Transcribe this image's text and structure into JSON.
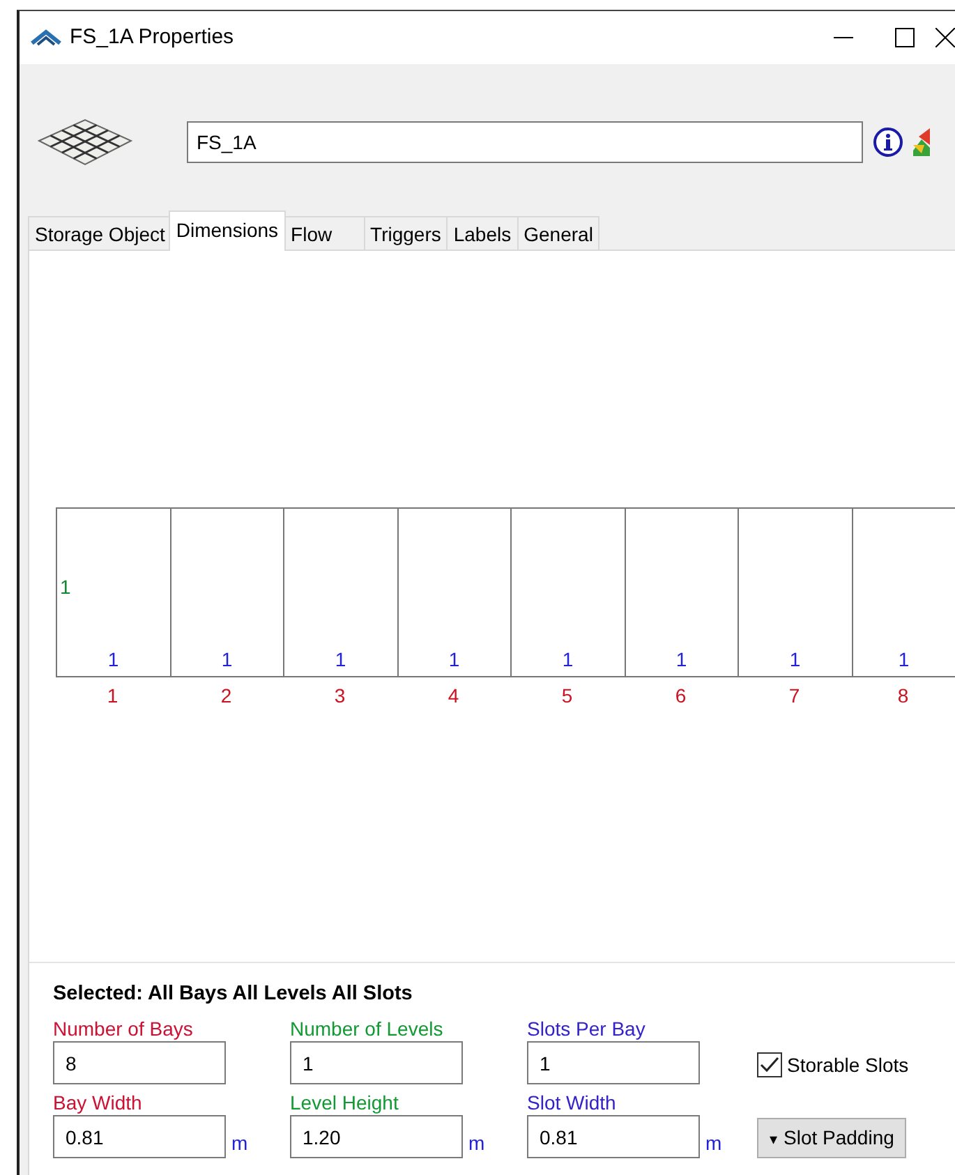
{
  "window": {
    "title": "FS_1A  Properties"
  },
  "object_name": {
    "value": "FS_1A"
  },
  "tabs": [
    {
      "label": "Storage Object",
      "selected": false
    },
    {
      "label": "Dimensions",
      "selected": true
    },
    {
      "label": "Flow",
      "selected": false
    },
    {
      "label": "Triggers",
      "selected": false
    },
    {
      "label": "Labels",
      "selected": false
    },
    {
      "label": "General",
      "selected": false
    }
  ],
  "diagram": {
    "level_label": "1",
    "bays": [
      {
        "slots": "1",
        "bay": "1"
      },
      {
        "slots": "1",
        "bay": "2"
      },
      {
        "slots": "1",
        "bay": "3"
      },
      {
        "slots": "1",
        "bay": "4"
      },
      {
        "slots": "1",
        "bay": "5"
      },
      {
        "slots": "1",
        "bay": "6"
      },
      {
        "slots": "1",
        "bay": "7"
      },
      {
        "slots": "1",
        "bay": "8"
      }
    ]
  },
  "selection": "Selected: All Bays All Levels All Slots",
  "fields": [
    {
      "label": "Number of Bays",
      "value": "8",
      "color": "#cc1133"
    },
    {
      "label": "Number of Levels",
      "value": "1",
      "color": "#119933"
    },
    {
      "label": "Slots Per Bay",
      "value": "1",
      "color": "#3322cc"
    },
    {
      "label": "Bay Width",
      "value": "0.81",
      "unit": "m",
      "color": "#cc1133"
    },
    {
      "label": "Level Height",
      "value": "1.20",
      "unit": "m",
      "color": "#119933"
    },
    {
      "label": "Slot Width",
      "value": "0.81",
      "unit": "m",
      "color": "#3322cc"
    }
  ],
  "storable_slots": {
    "label": "Storable Slots",
    "checked": true
  },
  "slot_padding_button": {
    "glyph": "▾",
    "label": "Slot Padding"
  }
}
